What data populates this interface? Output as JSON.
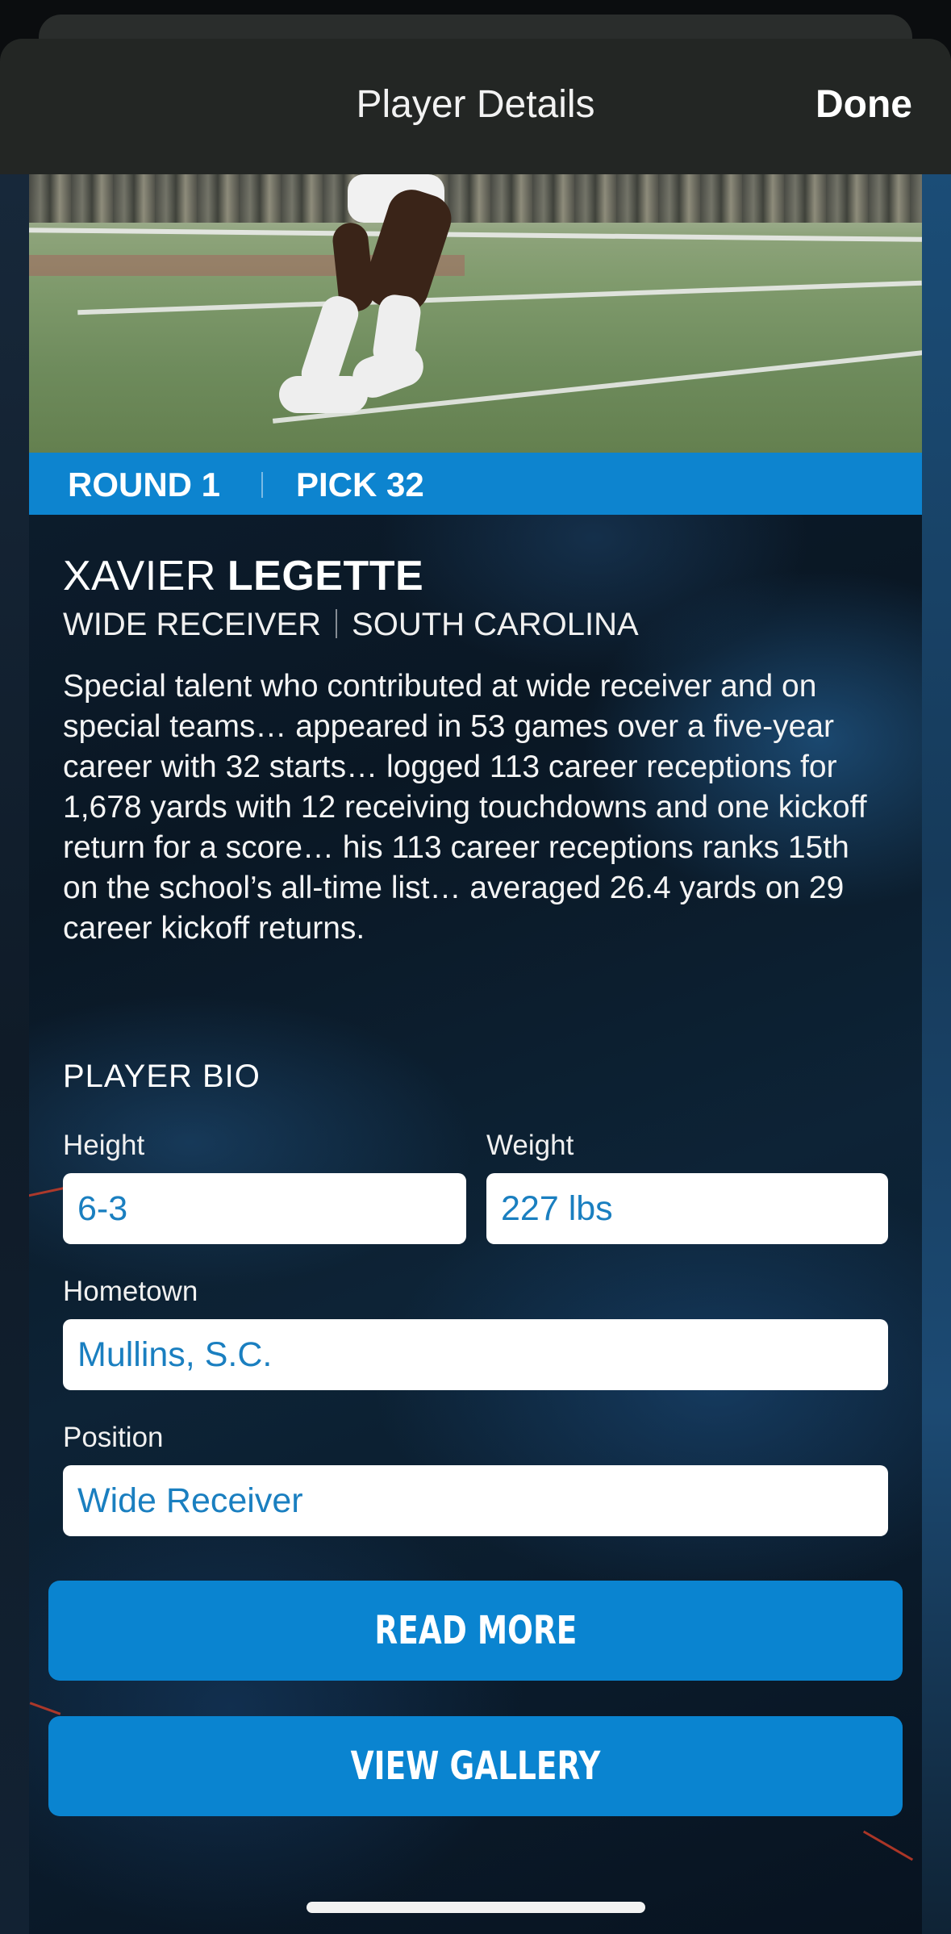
{
  "navbar": {
    "title": "Player Details",
    "done_label": "Done"
  },
  "draft": {
    "round_label": "ROUND 1",
    "pick_label": "PICK 32"
  },
  "player": {
    "first_name": "XAVIER",
    "last_name": "LEGETTE",
    "position_upper": "WIDE RECEIVER",
    "school": "SOUTH CAROLINA",
    "summary": "Special talent who contributed at wide receiver and on special teams… appeared in 53 games over a five-year career with 32 starts… logged 113 career receptions for 1,678 yards with 12 receiving touchdowns and one kickoff return for a score… his 113 career receptions ranks 15th on the school’s all-time list… averaged 26.4 yards on 29 career kickoff returns."
  },
  "bio": {
    "heading": "PLAYER BIO",
    "height_label": "Height",
    "height_value": "6-3",
    "weight_label": "Weight",
    "weight_value": "227 lbs",
    "hometown_label": "Hometown",
    "hometown_value": "Mullins, S.C.",
    "position_label": "Position",
    "position_value": "Wide Receiver"
  },
  "actions": {
    "read_more": "READ MORE",
    "view_gallery": "VIEW GALLERY"
  },
  "colors": {
    "accent": "#0A84D0",
    "value_text": "#1A7FC0",
    "navbar_bg": "#232624"
  }
}
